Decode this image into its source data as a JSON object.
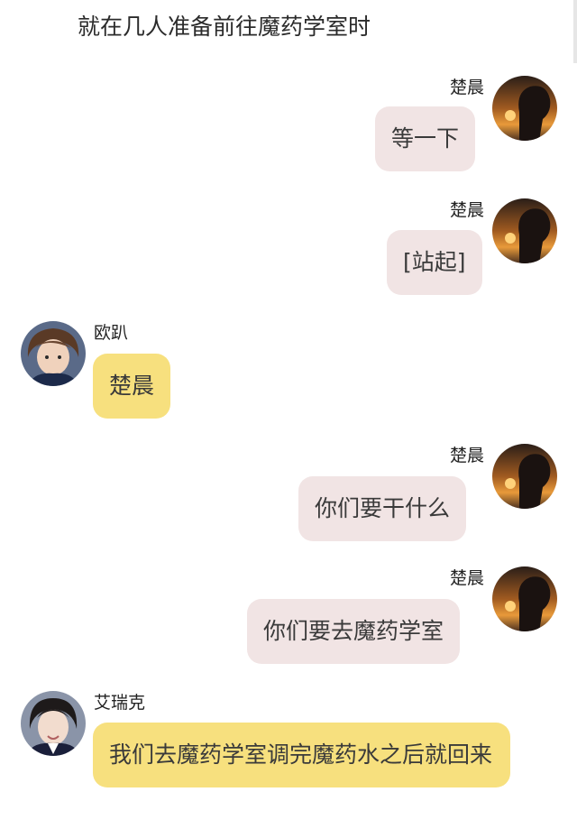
{
  "narration": "就在几人准备前往魔药学室时",
  "messages": [
    {
      "side": "right",
      "name": "楚晨",
      "text": "等一下"
    },
    {
      "side": "right",
      "name": "楚晨",
      "text": "[站起]"
    },
    {
      "side": "left",
      "name": "欧趴",
      "text": "楚晨"
    },
    {
      "side": "right",
      "name": "楚晨",
      "text": "你们要干什么"
    },
    {
      "side": "right",
      "name": "楚晨",
      "text": "你们要去魔药学室"
    },
    {
      "side": "left",
      "name": "艾瑞克",
      "text": "我们去魔药学室调完魔药水之后就回来"
    }
  ],
  "colors": {
    "right_bubble": "#f1e4e4",
    "left_bubble": "#f7e07e"
  }
}
